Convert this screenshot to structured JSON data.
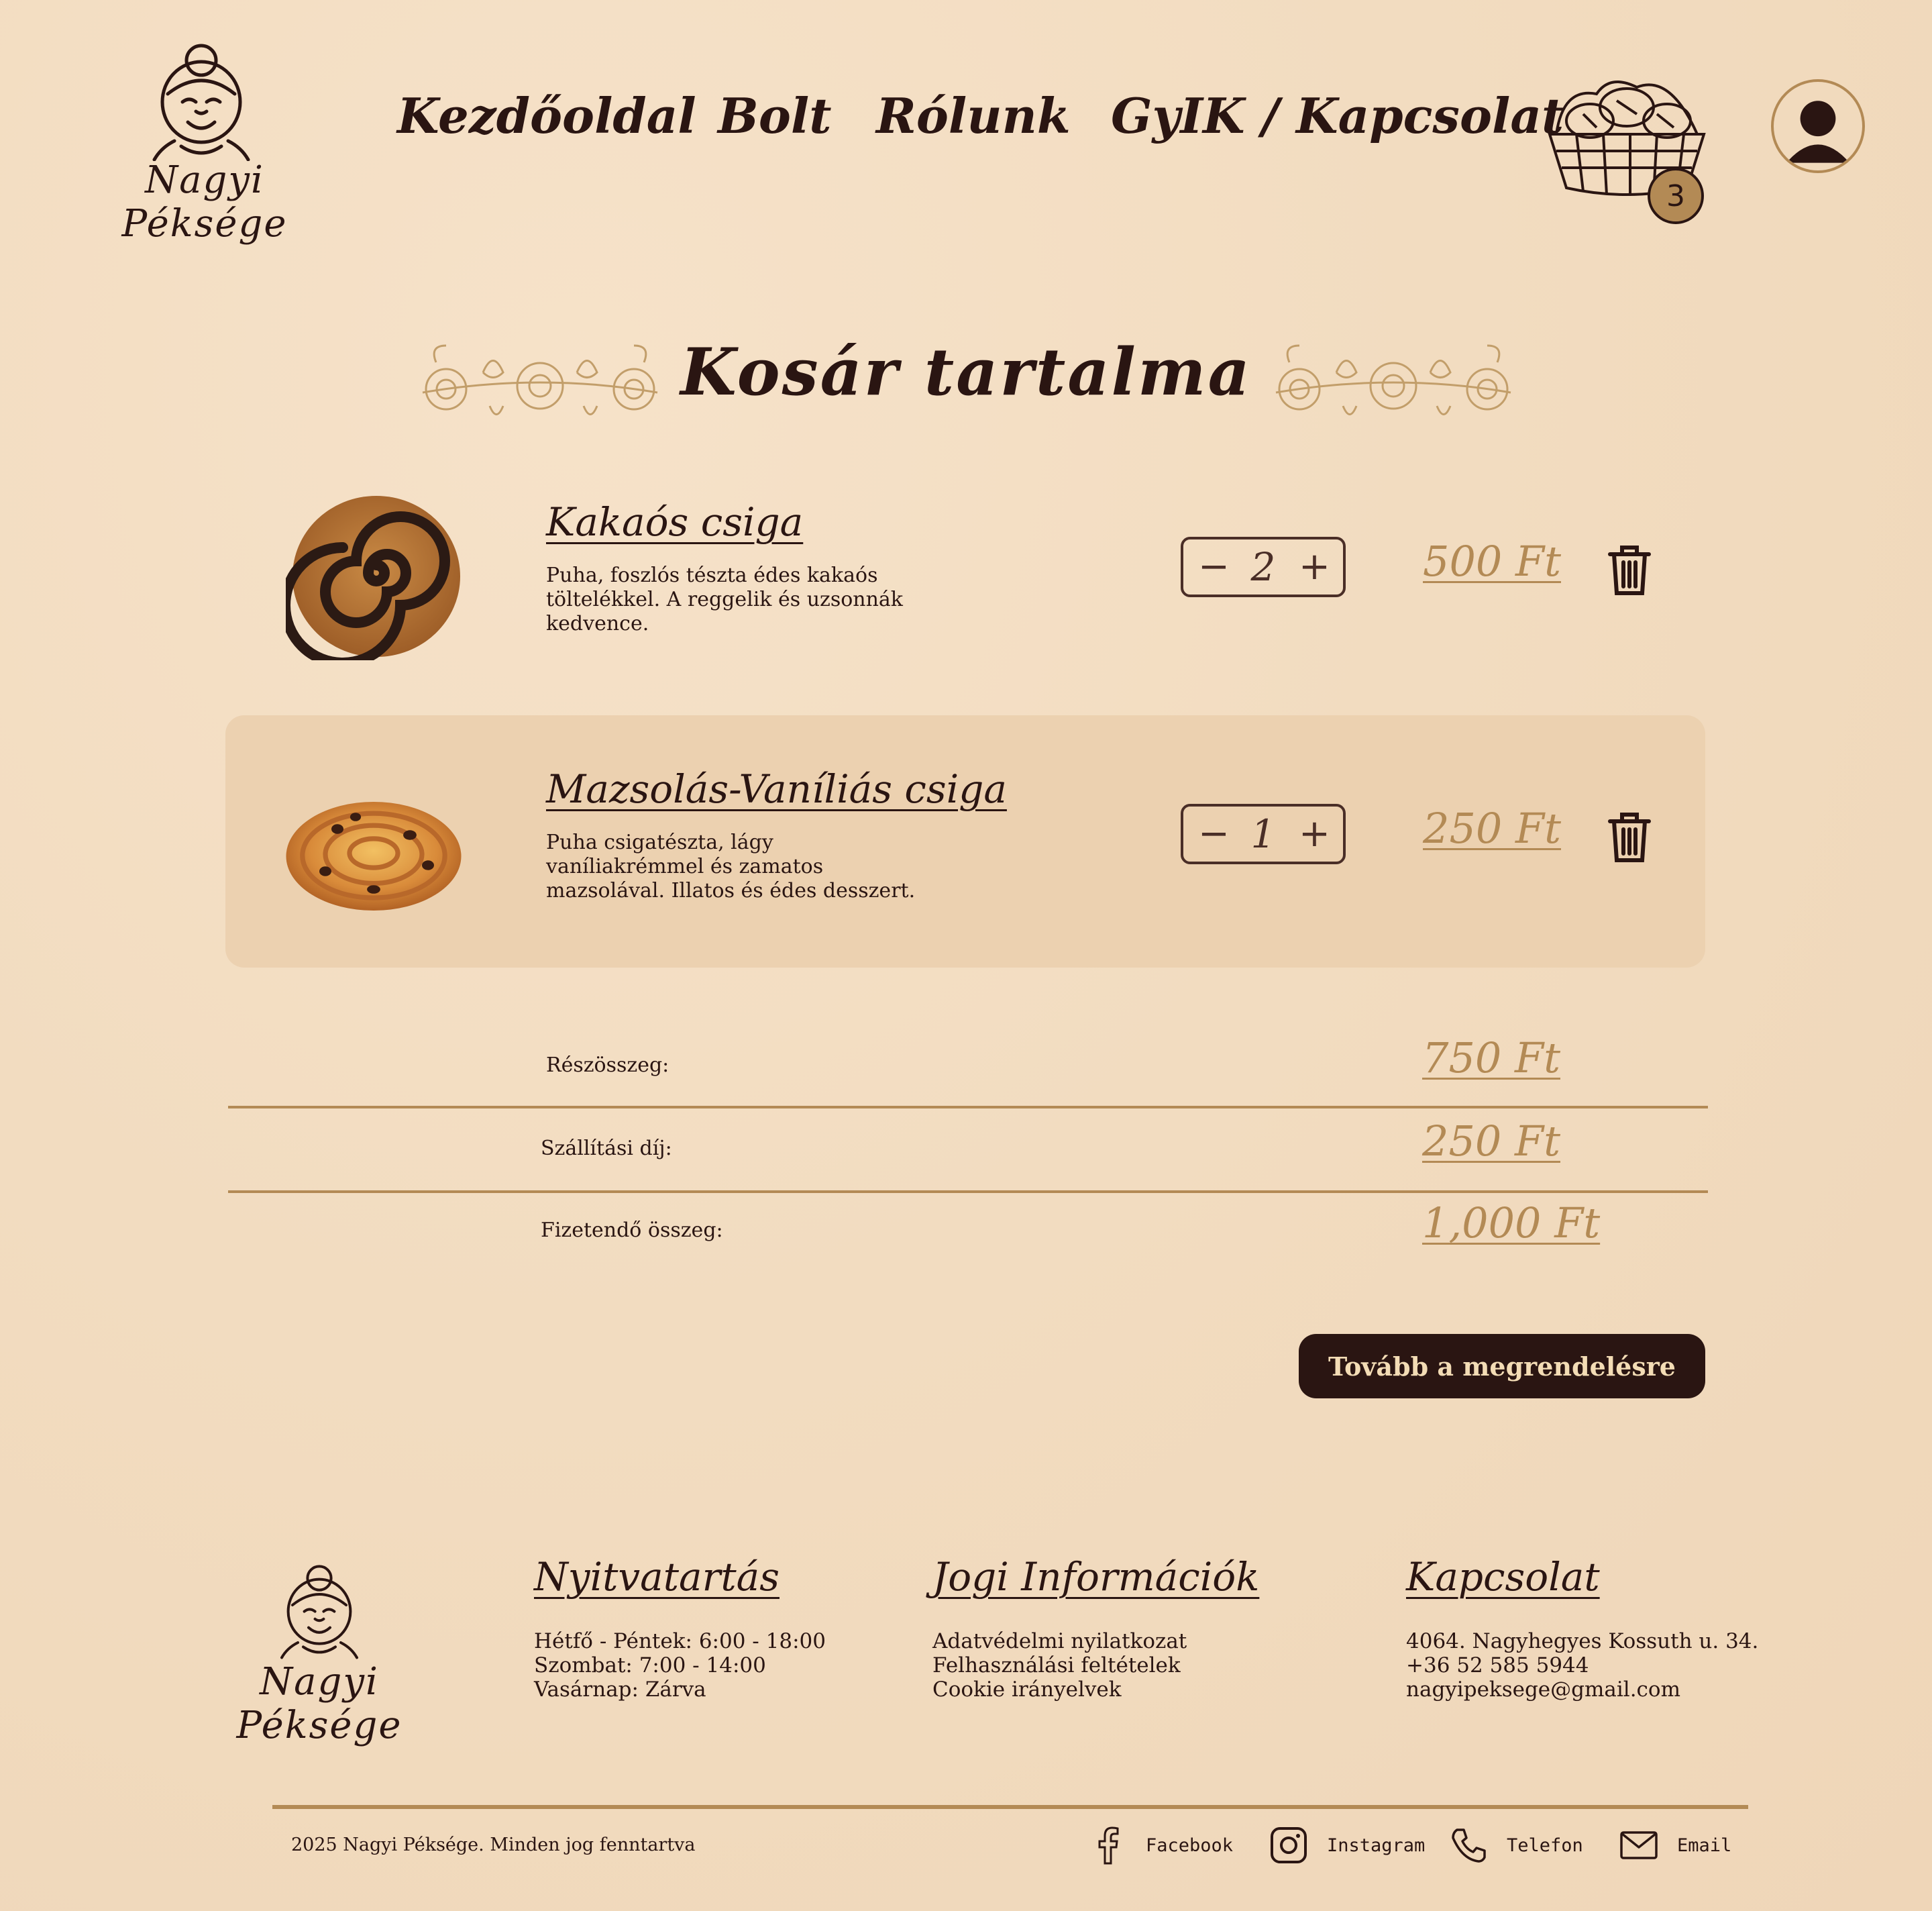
{
  "brand": {
    "name": "Nagyi Péksége"
  },
  "nav": {
    "items": [
      {
        "label": "Kezdőoldal"
      },
      {
        "label": "Bolt"
      },
      {
        "label": "Rólunk"
      },
      {
        "label": "GyIK / Kapcsolat"
      }
    ]
  },
  "cart": {
    "count": "3"
  },
  "page": {
    "title": "Kosár tartalma"
  },
  "items": [
    {
      "name": "Kakaós csiga",
      "description": "Puha, foszlós tészta édes kakaós töltelékkel. A reggelik és uzsonnák kedvence.",
      "quantity": "2",
      "price": "500 Ft"
    },
    {
      "name": "Mazsolás-Vaníliás csiga",
      "description": "Puha csigatészta, lágy vaníliakrémmel és zamatos mazsolával. Illatos és édes desszert.",
      "quantity": "1",
      "price": "250 Ft"
    }
  ],
  "qty_controls": {
    "minus": "−",
    "plus": "+"
  },
  "summary": {
    "subtotal_label": "Részösszeg:",
    "subtotal_value": "750 Ft",
    "shipping_label": "Szállítási díj:",
    "shipping_value": "250 Ft",
    "total_label": "Fizetendő összeg:",
    "total_value": "1,000 Ft"
  },
  "checkout_label": "Tovább a megrendelésre",
  "footer": {
    "hours": {
      "title": "Nyitvatartás",
      "lines": [
        "Hétfő - Péntek: 6:00 - 18:00",
        "Szombat: 7:00 - 14:00",
        "Vasárnap: Zárva"
      ]
    },
    "legal": {
      "title": "Jogi Információk",
      "lines": [
        "Adatvédelmi nyilatkozat",
        "Felhasználási feltételek",
        "Cookie irányelvek"
      ]
    },
    "contact": {
      "title": "Kapcsolat",
      "lines": [
        "4064. Nagyhegyes Kossuth u. 34.",
        "+36 52 585 5944",
        "nagyipeksege@gmail.com"
      ]
    },
    "copyright": "2025 Nagyi Péksége. Minden jog fenntartva",
    "social": [
      {
        "label": "Facebook",
        "icon": "facebook-icon"
      },
      {
        "label": "Instagram",
        "icon": "instagram-icon"
      },
      {
        "label": "Telefon",
        "icon": "phone-icon"
      },
      {
        "label": "Email",
        "icon": "email-icon"
      }
    ]
  },
  "colors": {
    "background": "#f2dcc0",
    "text": "#2a1512",
    "accent": "#b38a55",
    "highlight_row": "#ecd1b0",
    "button_bg": "#2a1512",
    "button_text": "#f3dcb5"
  }
}
